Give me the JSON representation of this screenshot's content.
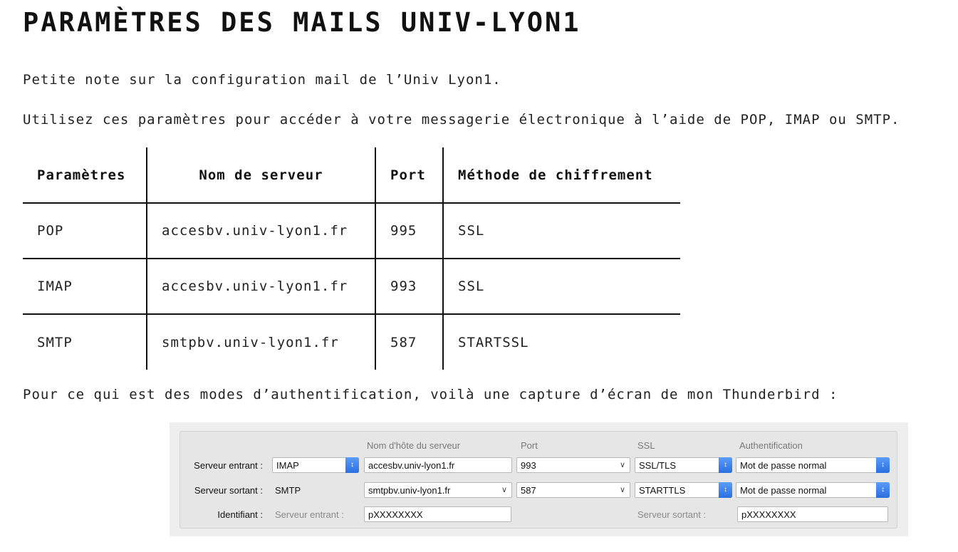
{
  "title": "PARAMÈTRES DES MAILS UNIV-LYON1",
  "intro": "Petite note sur la configuration mail de l’Univ Lyon1.",
  "usage": "Utilisez ces paramètres pour accéder à votre messagerie électronique à l’aide de POP, IMAP ou SMTP.",
  "table": {
    "headers": [
      "Paramètres",
      "Nom de serveur",
      "Port",
      "Méthode de chiffrement"
    ],
    "rows": [
      [
        "POP",
        "accesbv.univ-lyon1.fr",
        "995",
        "SSL"
      ],
      [
        "IMAP",
        "accesbv.univ-lyon1.fr",
        "993",
        "SSL"
      ],
      [
        "SMTP",
        "smtpbv.univ-lyon1.fr",
        "587",
        "STARTSSL"
      ]
    ]
  },
  "auth_note": "Pour ce qui est des modes d’authentification, voilà une capture d’écran de mon Thunderbird :",
  "thunderbird": {
    "headers": {
      "hostname": "Nom d'hôte du serveur",
      "port": "Port",
      "ssl": "SSL",
      "auth": "Authentification"
    },
    "incoming": {
      "label": "Serveur entrant :",
      "protocol": "IMAP",
      "hostname": "accesbv.univ-lyon1.fr",
      "port": "993",
      "ssl": "SSL/TLS",
      "auth": "Mot de passe normal"
    },
    "outgoing": {
      "label": "Serveur sortant :",
      "protocol": "SMTP",
      "hostname": "smtpbv.univ-lyon1.fr",
      "port": "587",
      "ssl": "STARTTLS",
      "auth": "Mot de passe normal"
    },
    "identifier": {
      "label": "Identifiant :",
      "incoming_label": "Serveur entrant :",
      "incoming_value": "pXXXXXXXX",
      "outgoing_label": "Serveur sortant :",
      "outgoing_value": "pXXXXXXXX"
    },
    "colors": {
      "stepper": "#3b82f6",
      "panel": "#e6e6e6"
    }
  }
}
